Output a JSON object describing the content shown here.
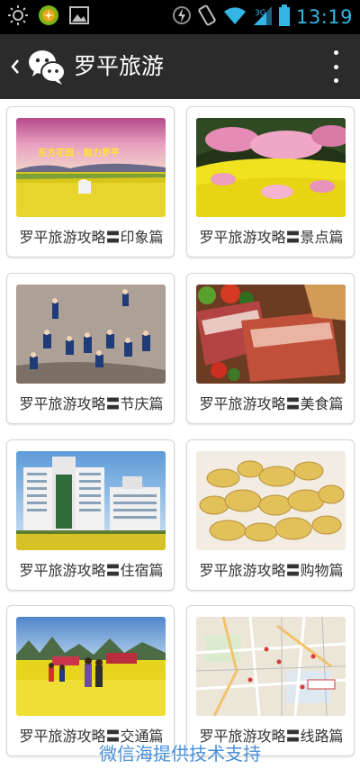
{
  "status_bar": {
    "time": "13:19",
    "icons": [
      "brightness-icon",
      "app-badge-icon",
      "image-icon",
      "flash-icon",
      "vibrate-icon",
      "wifi-icon",
      "signal-icon",
      "battery-icon"
    ]
  },
  "action_bar": {
    "title": "罗平旅游",
    "back_icon": "chevron-left-icon",
    "logo_icon": "wechat-logo-icon",
    "menu_icon": "overflow-menu-icon"
  },
  "cards": [
    {
      "label": "罗平旅游攻略〓印象篇",
      "image": "canola-field-banner"
    },
    {
      "label": "罗平旅游攻略〓景点篇",
      "image": "blossom-landscape"
    },
    {
      "label": "罗平旅游攻略〓节庆篇",
      "image": "river-festival"
    },
    {
      "label": "罗平旅游攻略〓美食篇",
      "image": "cured-meat"
    },
    {
      "label": "罗平旅游攻略〓住宿篇",
      "image": "hotel-building"
    },
    {
      "label": "罗平旅游攻略〓购物篇",
      "image": "ginger-roots"
    },
    {
      "label": "罗平旅游攻略〓交通篇",
      "image": "flower-field-people"
    },
    {
      "label": "罗平旅游攻略〓线路篇",
      "image": "route-map"
    }
  ],
  "banner_text": "东方花园 · 魅力罗平",
  "footer": {
    "text": "微信海提供技术支持"
  },
  "colors": {
    "status_accent": "#33b5e5",
    "action_bar_bg": "#2b2b2b",
    "footer_text": "#4a90d9"
  }
}
